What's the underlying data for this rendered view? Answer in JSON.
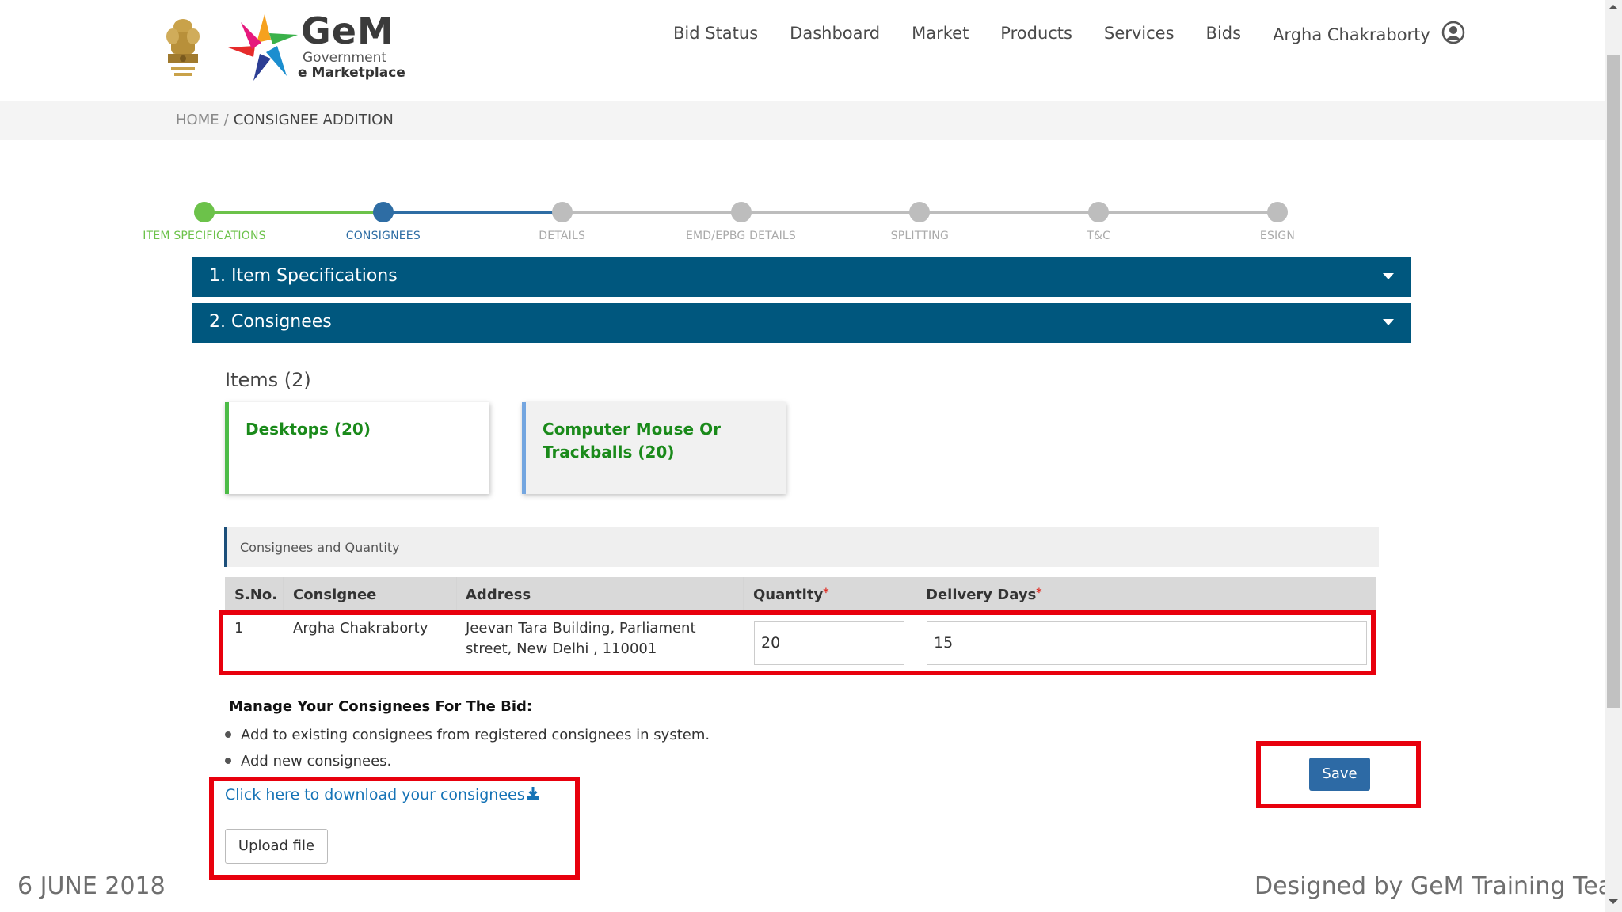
{
  "header": {
    "brand_title": "GeM",
    "brand_sub1": "Government",
    "brand_sub2": "e Marketplace",
    "nav": [
      "Bid Status",
      "Dashboard",
      "Market",
      "Products",
      "Services",
      "Bids"
    ],
    "user_name": "Argha Chakraborty"
  },
  "breadcrumb": {
    "home": "HOME",
    "separator": "/",
    "current": "CONSIGNEE ADDITION"
  },
  "stepper": {
    "steps": [
      {
        "label": "ITEM SPECIFICATIONS",
        "state": "done"
      },
      {
        "label": "CONSIGNEES",
        "state": "active"
      },
      {
        "label": "DETAILS",
        "state": "todo"
      },
      {
        "label": "EMD/EPBG DETAILS",
        "state": "todo"
      },
      {
        "label": "SPLITTING",
        "state": "todo"
      },
      {
        "label": "T&C",
        "state": "todo"
      },
      {
        "label": "ESIGN",
        "state": "todo"
      }
    ],
    "colors": {
      "done": "#6cc24a",
      "active": "#2e6da4",
      "todo": "#bdbdbd"
    }
  },
  "sections": {
    "item_specs": "1. Item Specifications",
    "consignees": "2. Consignees"
  },
  "items": {
    "heading": "Items (2)",
    "cards": [
      {
        "text": "Desktops  (20)"
      },
      {
        "text": "Computer Mouse Or Trackballs  (20)"
      }
    ]
  },
  "consignee_table": {
    "section_label": "Consignees and Quantity",
    "headers": {
      "sno": "S.No.",
      "consignee": "Consignee",
      "address": "Address",
      "quantity": "Quantity",
      "delivery": "Delivery Days",
      "required_mark": "*"
    },
    "rows": [
      {
        "sno": "1",
        "consignee": "Argha Chakraborty",
        "address": "Jeevan Tara Building, Parliament street, New Delhi , 110001",
        "quantity": "20",
        "delivery_days": "15"
      }
    ]
  },
  "manage": {
    "title": "Manage Your Consignees For The Bid:",
    "bullets": [
      "Add to existing consignees from registered consignees in system.",
      "Add new consignees."
    ],
    "download_link": "Click here to download your consignees",
    "upload_button": "Upload file"
  },
  "save_button": "Save",
  "footer": {
    "date": "6 JUNE 2018",
    "credit": "Designed by GeM Training Team"
  },
  "colors": {
    "accent_bar": "#00577e",
    "highlight": "#e8000d",
    "save": "#2d6aa5",
    "link": "#1573b6"
  }
}
